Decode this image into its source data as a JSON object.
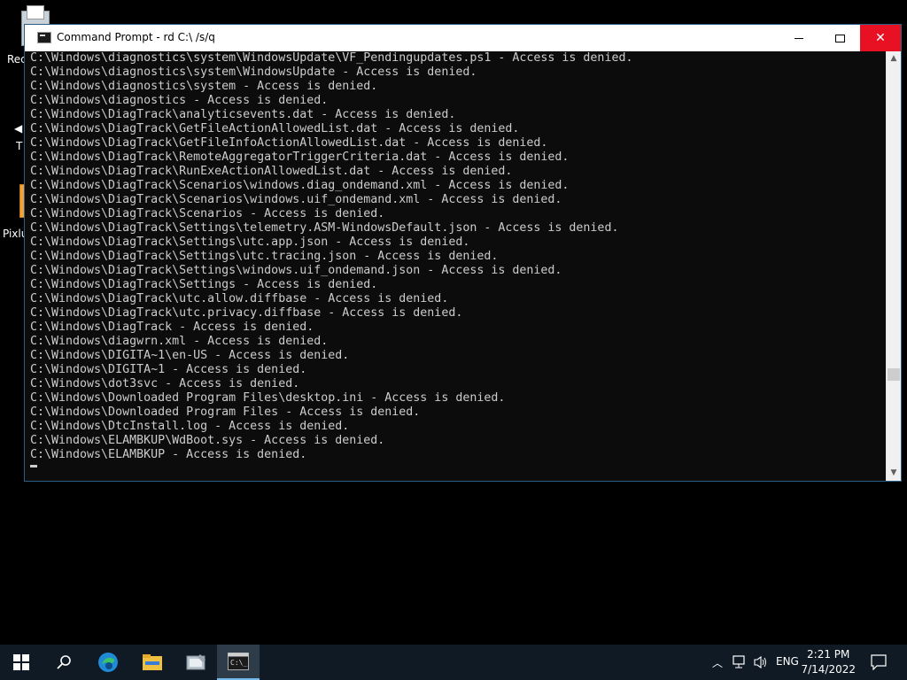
{
  "desktop": {
    "icons": [
      {
        "label": "Rec"
      },
      {
        "label": "T"
      },
      {
        "label": "Pixlu"
      }
    ]
  },
  "window": {
    "title": "Command Prompt - rd  C:\\ /s/q",
    "buttons": {
      "minimize": "minimize",
      "maximize": "maximize",
      "close": "close"
    }
  },
  "console": {
    "lines": [
      "C:\\Windows\\diagnostics\\system\\WindowsUpdate\\VF_Pendingupdates.ps1 - Access is denied.",
      "C:\\Windows\\diagnostics\\system\\WindowsUpdate - Access is denied.",
      "C:\\Windows\\diagnostics\\system - Access is denied.",
      "C:\\Windows\\diagnostics - Access is denied.",
      "C:\\Windows\\DiagTrack\\analyticsevents.dat - Access is denied.",
      "C:\\Windows\\DiagTrack\\GetFileActionAllowedList.dat - Access is denied.",
      "C:\\Windows\\DiagTrack\\GetFileInfoActionAllowedList.dat - Access is denied.",
      "C:\\Windows\\DiagTrack\\RemoteAggregatorTriggerCriteria.dat - Access is denied.",
      "C:\\Windows\\DiagTrack\\RunExeActionAllowedList.dat - Access is denied.",
      "C:\\Windows\\DiagTrack\\Scenarios\\windows.diag_ondemand.xml - Access is denied.",
      "C:\\Windows\\DiagTrack\\Scenarios\\windows.uif_ondemand.xml - Access is denied.",
      "C:\\Windows\\DiagTrack\\Scenarios - Access is denied.",
      "C:\\Windows\\DiagTrack\\Settings\\telemetry.ASM-WindowsDefault.json - Access is denied.",
      "C:\\Windows\\DiagTrack\\Settings\\utc.app.json - Access is denied.",
      "C:\\Windows\\DiagTrack\\Settings\\utc.tracing.json - Access is denied.",
      "C:\\Windows\\DiagTrack\\Settings\\windows.uif_ondemand.json - Access is denied.",
      "C:\\Windows\\DiagTrack\\Settings - Access is denied.",
      "C:\\Windows\\DiagTrack\\utc.allow.diffbase - Access is denied.",
      "C:\\Windows\\DiagTrack\\utc.privacy.diffbase - Access is denied.",
      "C:\\Windows\\DiagTrack - Access is denied.",
      "C:\\Windows\\diagwrn.xml - Access is denied.",
      "C:\\Windows\\DIGITA~1\\en-US - Access is denied.",
      "C:\\Windows\\DIGITA~1 - Access is denied.",
      "C:\\Windows\\dot3svc - Access is denied.",
      "C:\\Windows\\Downloaded Program Files\\desktop.ini - Access is denied.",
      "C:\\Windows\\Downloaded Program Files - Access is denied.",
      "C:\\Windows\\DtcInstall.log - Access is denied.",
      "C:\\Windows\\ELAMBKUP\\WdBoot.sys - Access is denied.",
      "C:\\Windows\\ELAMBKUP - Access is denied."
    ]
  },
  "taskbar": {
    "apps": [
      {
        "name": "start",
        "icon": "windows-logo-icon"
      },
      {
        "name": "search",
        "icon": "search-icon"
      },
      {
        "name": "edge",
        "icon": "edge-icon"
      },
      {
        "name": "file-explorer",
        "icon": "folder-icon"
      },
      {
        "name": "tool",
        "icon": "tool-icon"
      },
      {
        "name": "command-prompt",
        "icon": "cmd-icon",
        "active": true
      }
    ],
    "tray": {
      "language": "ENG",
      "time": "2:21 PM",
      "date": "7/14/2022"
    },
    "colors": {
      "background": "#101a24",
      "accent": "#76b9ed",
      "close": "#e81123"
    }
  }
}
